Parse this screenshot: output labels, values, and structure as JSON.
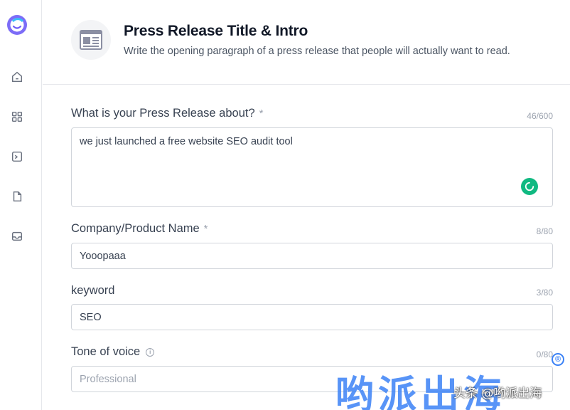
{
  "sidebar": {
    "logo": "jasper-logo-icon",
    "items": [
      {
        "icon": "home-icon"
      },
      {
        "icon": "grid-icon"
      },
      {
        "icon": "terminal-icon"
      },
      {
        "icon": "document-icon"
      },
      {
        "icon": "inbox-icon"
      }
    ]
  },
  "header": {
    "icon": "newspaper-icon",
    "title": "Press Release Title & Intro",
    "subtitle": "Write the opening paragraph of a press release that people will actually want to read."
  },
  "form": {
    "about": {
      "label": "What is your Press Release about?",
      "required_mark": "*",
      "counter": "46/600",
      "value": "we just launched a free website SEO audit tool"
    },
    "company": {
      "label": "Company/Product Name",
      "required_mark": "*",
      "counter": "8/80",
      "value": "Yooopaaa"
    },
    "keyword": {
      "label": "keyword",
      "counter": "3/80",
      "value": "SEO"
    },
    "tone": {
      "label": "Tone of voice",
      "info_icon": "i",
      "counter": "0/80",
      "placeholder": "Professional"
    }
  },
  "watermark": {
    "big_text": "哟派出海",
    "small_text": "头条 @哟派出海",
    "registered": "®"
  },
  "colors": {
    "accent": "#3b82f6",
    "spinner": "#10b981",
    "logo": "#6d5df6"
  }
}
